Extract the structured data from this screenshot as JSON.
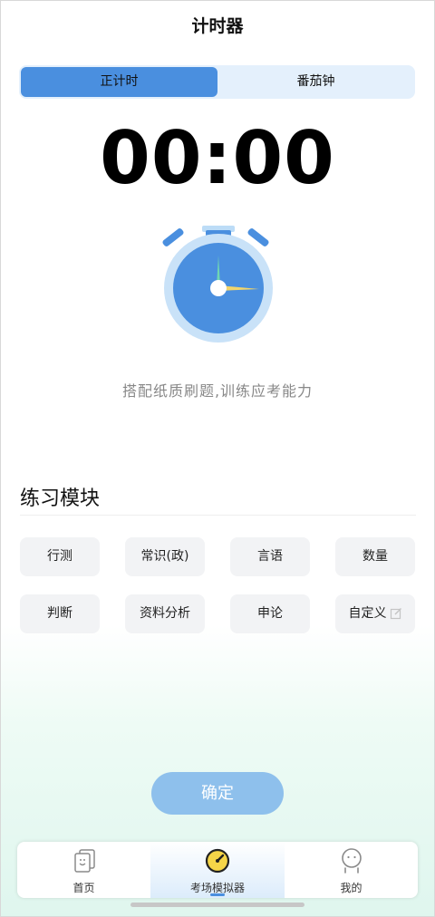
{
  "header": {
    "title": "计时器"
  },
  "mode_tabs": [
    {
      "label": "正计时",
      "active": true
    },
    {
      "label": "番茄钟",
      "active": false
    }
  ],
  "timer": {
    "display": "00:00"
  },
  "clock_icon": "stopwatch-icon",
  "tagline": "搭配纸质刷题,训练应考能力",
  "practice": {
    "title": "练习模块",
    "modules": [
      "行测",
      "常识(政)",
      "言语",
      "数量",
      "判断",
      "资料分析",
      "申论",
      "自定义"
    ]
  },
  "confirm_label": "确定",
  "bottom_nav": [
    {
      "label": "首页",
      "icon": "cards-icon",
      "active": false
    },
    {
      "label": "考场模拟器",
      "icon": "timer-gauge-icon",
      "active": true
    },
    {
      "label": "我的",
      "icon": "profile-face-icon",
      "active": false
    }
  ],
  "colors": {
    "accent": "#4a8fdf",
    "segment_bg": "#e4f0fc",
    "confirm_bg": "#8ec0ec",
    "chip_bg": "#f2f3f5"
  }
}
